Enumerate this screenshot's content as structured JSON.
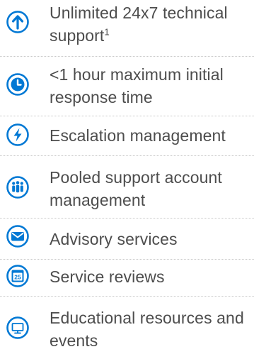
{
  "accent_color": "#0078d4",
  "text_color": "#4d4d4d",
  "items": [
    {
      "icon": "arrow-up-circle-icon",
      "label": "Unlimited 24x7 technical support",
      "sup": "1"
    },
    {
      "icon": "clock-icon",
      "label": "<1 hour maximum initial response time"
    },
    {
      "icon": "lightning-bolt-icon",
      "label": "Escalation management"
    },
    {
      "icon": "people-group-icon",
      "label": "Pooled support account management"
    },
    {
      "icon": "envelope-icon",
      "label": "Advisory services"
    },
    {
      "icon": "calendar-icon",
      "label": "Service reviews",
      "badge": "25"
    },
    {
      "icon": "monitor-icon",
      "label": "Educational resources and events"
    }
  ]
}
